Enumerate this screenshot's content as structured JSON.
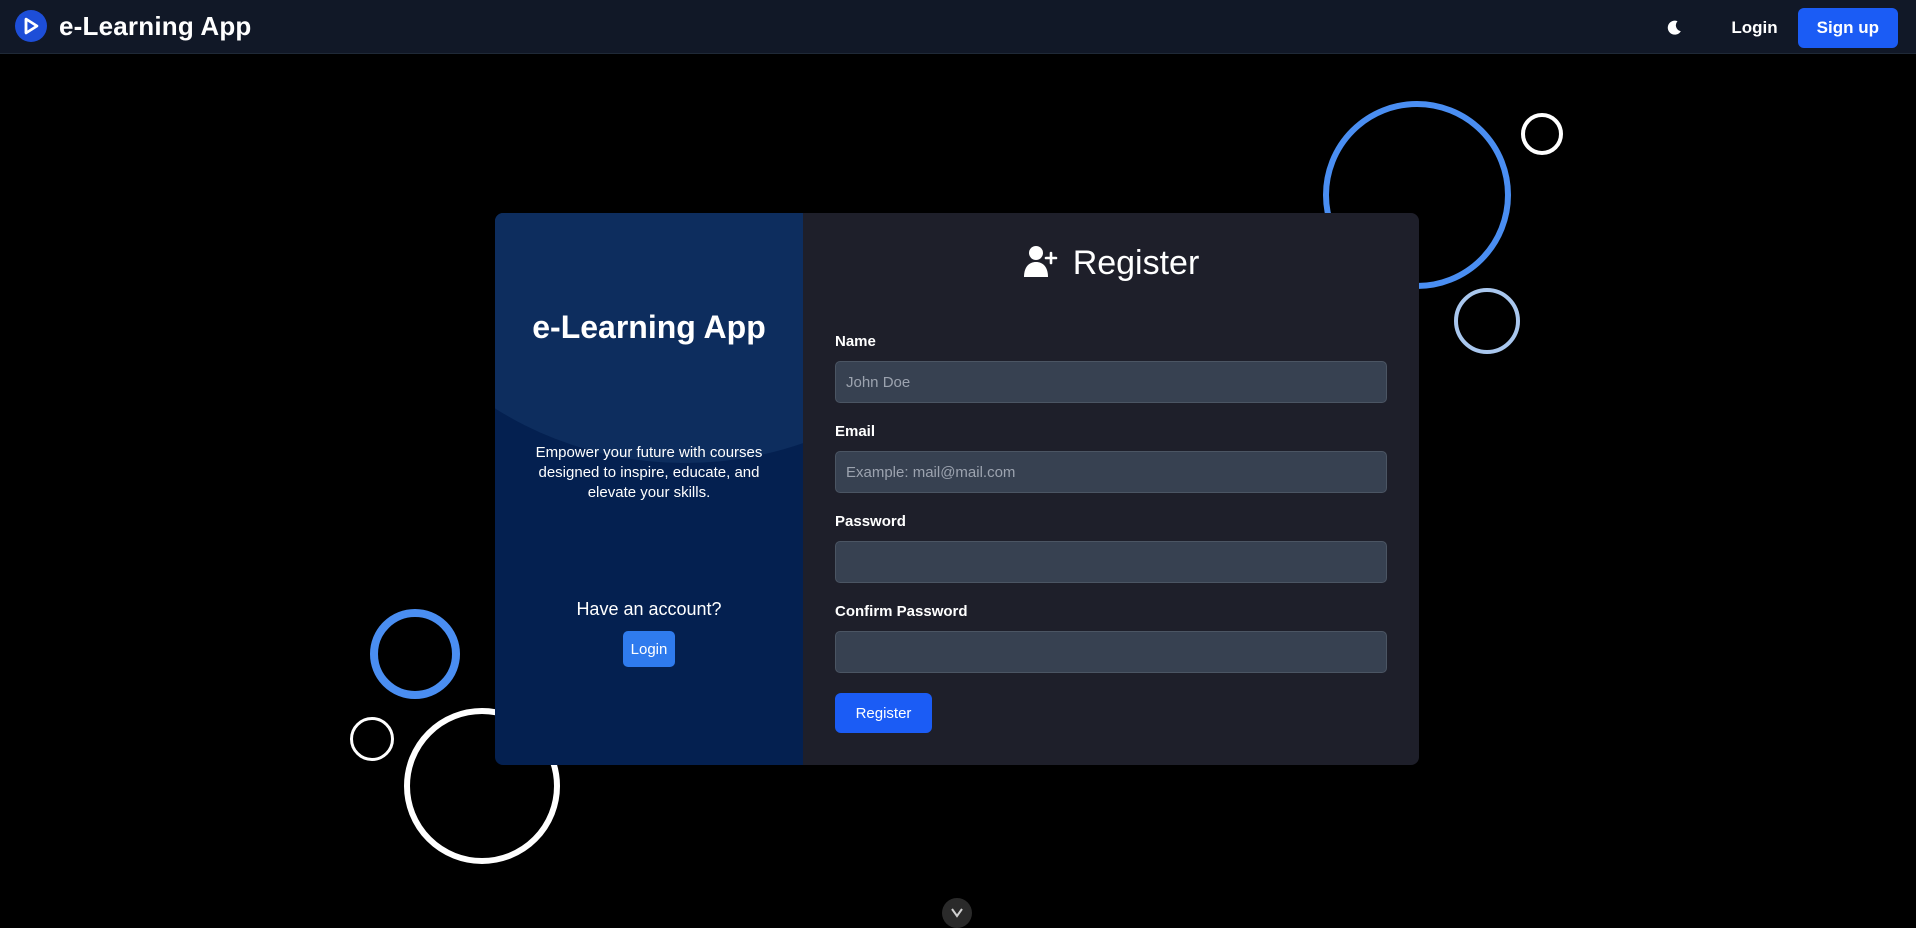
{
  "navbar": {
    "brand": "e-Learning App",
    "login_label": "Login",
    "signup_label": "Sign up",
    "theme_icon": "moon-icon"
  },
  "card_left": {
    "title": "e-Learning App",
    "tagline": "Empower your future with courses designed to inspire, educate, and elevate your skills.",
    "have_account": "Have an account?",
    "login_label": "Login"
  },
  "register": {
    "title": "Register",
    "icon": "user-plus-icon",
    "fields": {
      "name": {
        "label": "Name",
        "placeholder": "John Doe",
        "value": ""
      },
      "email": {
        "label": "Email",
        "placeholder": "Example: mail@mail.com",
        "value": ""
      },
      "password": {
        "label": "Password",
        "placeholder": "",
        "value": ""
      },
      "confirm_password": {
        "label": "Confirm Password",
        "placeholder": "",
        "value": ""
      }
    },
    "submit_label": "Register"
  },
  "colors": {
    "accent": "#1b5cf5",
    "navbar_bg": "#111827",
    "card_left_bg": "#042050",
    "card_right_bg": "#1e1f2a",
    "decor_blue": "#4a8ef2"
  }
}
